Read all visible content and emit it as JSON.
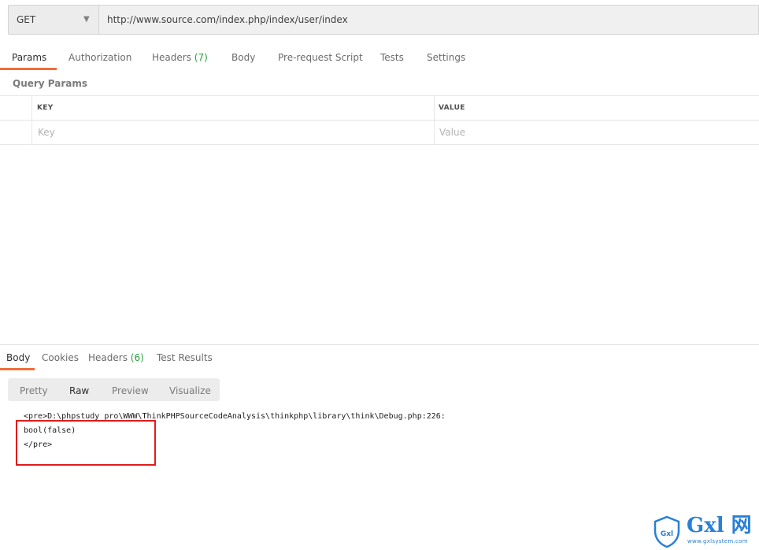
{
  "request": {
    "method": "GET",
    "url": "http://www.source.com/index.php/index/user/index"
  },
  "request_tabs": [
    {
      "label": "Params"
    },
    {
      "label": "Authorization"
    },
    {
      "label": "Headers",
      "count": "(7)"
    },
    {
      "label": "Body"
    },
    {
      "label": "Pre-request Script"
    },
    {
      "label": "Tests"
    },
    {
      "label": "Settings"
    }
  ],
  "query_params": {
    "section_label": "Query Params",
    "columns": [
      "KEY",
      "VALUE"
    ],
    "placeholders": {
      "key": "Key",
      "value": "Value"
    }
  },
  "response_tabs": [
    {
      "label": "Body"
    },
    {
      "label": "Cookies"
    },
    {
      "label": "Headers",
      "count": "(6)"
    },
    {
      "label": "Test Results"
    }
  ],
  "body_formats": [
    "Pretty",
    "Raw",
    "Preview",
    "Visualize"
  ],
  "response_body": [
    "<pre>D:\\phpstudy_pro\\WWW\\ThinkPHPSourceCodeAnalysis\\thinkphp\\library\\think\\Debug.php:226:",
    "bool(false)",
    "</pre>"
  ],
  "watermark": {
    "title": "Gxl 网",
    "shield_text": "Gxl",
    "subtitle": "www.gxlsystem.com"
  },
  "colors": {
    "accent": "#f26b3a",
    "count_green": "#26a13b",
    "highlight_red": "#e21b1b",
    "watermark_blue": "#2a7fd6"
  }
}
